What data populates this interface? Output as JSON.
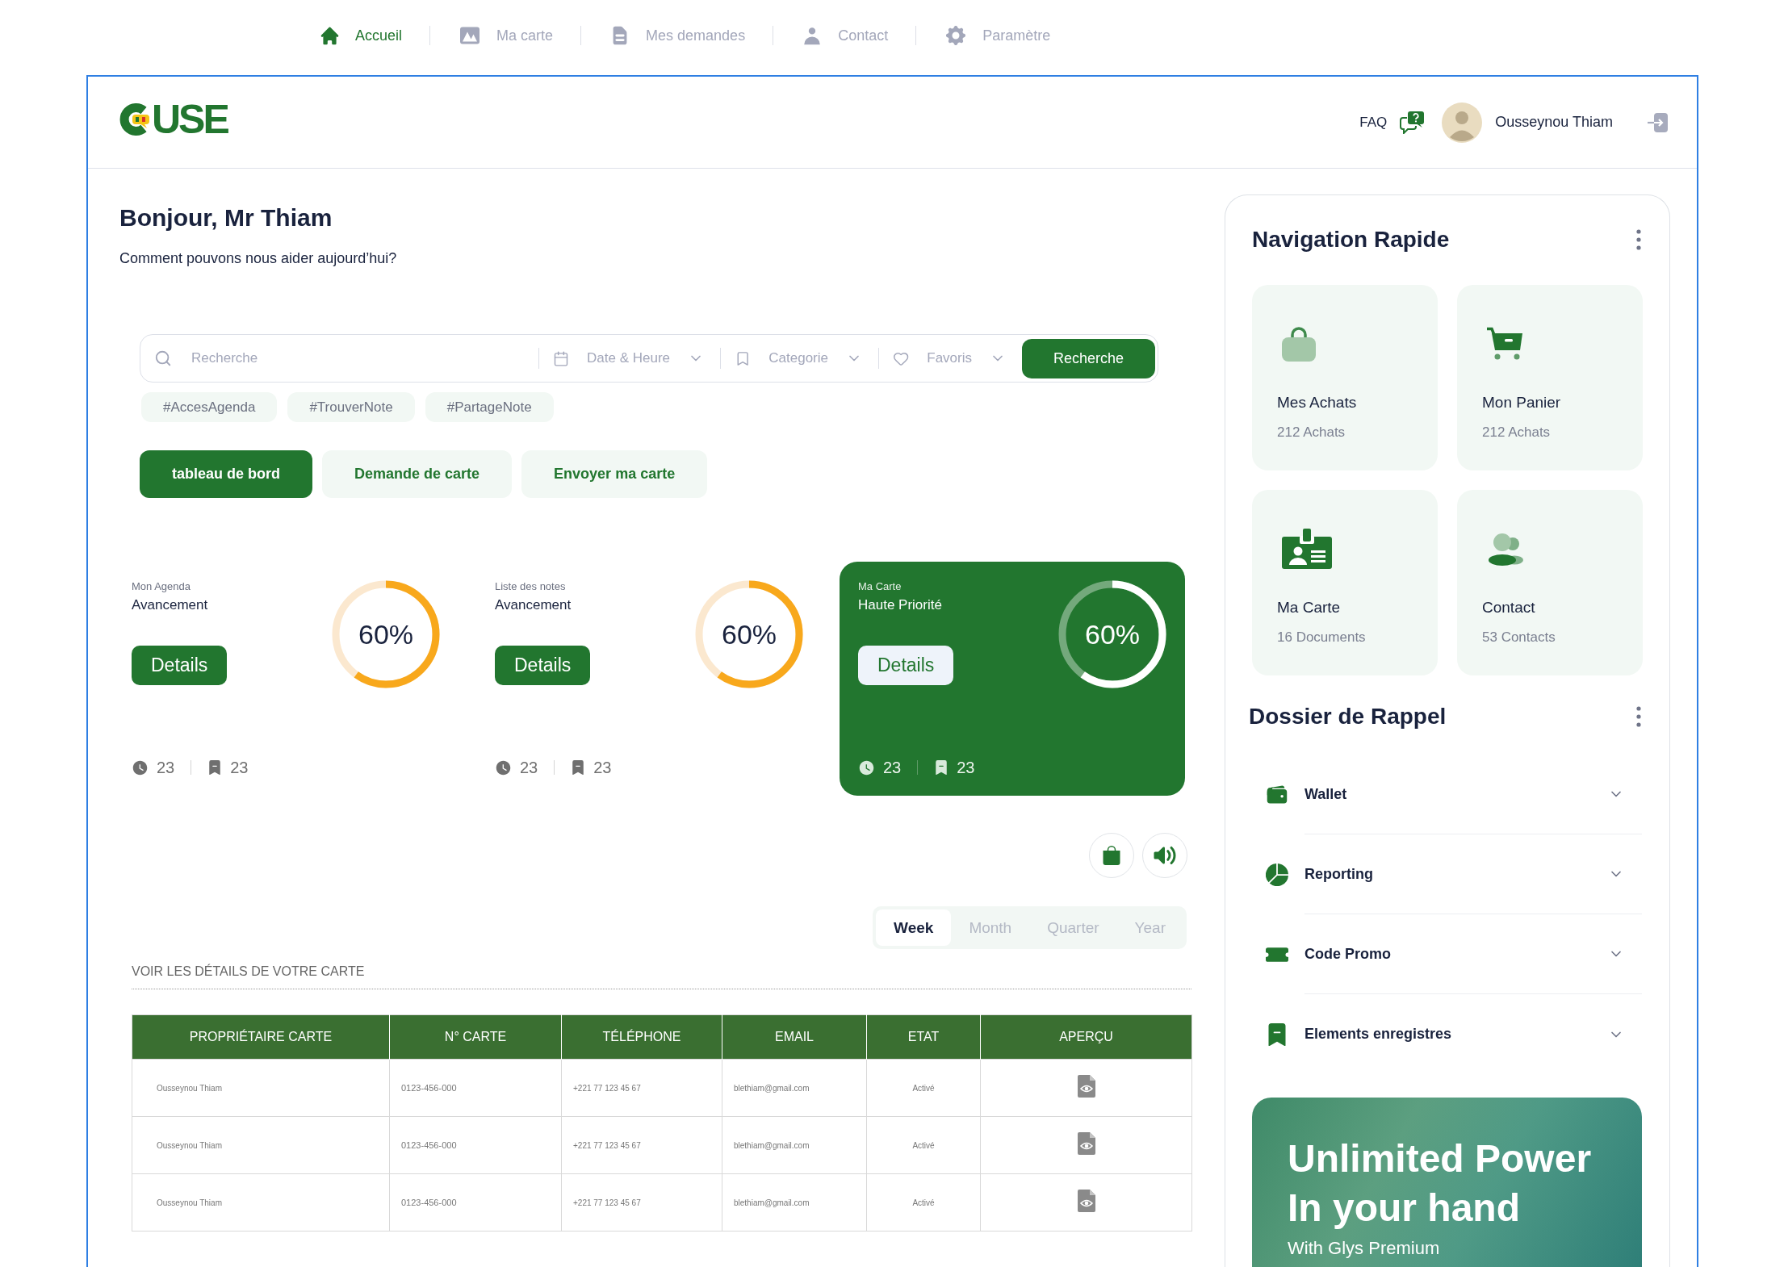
{
  "top_nav": {
    "items": [
      {
        "label": "Accueil",
        "selected": true
      },
      {
        "label": "Ma carte",
        "selected": false
      },
      {
        "label": "Mes demandes",
        "selected": false
      },
      {
        "label": "Contact",
        "selected": false
      },
      {
        "label": "Paramètre",
        "selected": false
      }
    ]
  },
  "header": {
    "logo": "USE",
    "faq": "FAQ",
    "user_name": "Ousseynou Thiam"
  },
  "greeting": {
    "title": "Bonjour, Mr Thiam",
    "subtitle": "Comment pouvons nous aider aujourd’hui?"
  },
  "search": {
    "placeholder": "Recherche",
    "filters": [
      "Date & Heure",
      "Categorie",
      "Favoris"
    ],
    "button": "Recherche"
  },
  "tags": [
    "#AccesAgenda",
    "#TrouverNote",
    "#PartageNote"
  ],
  "action_tabs": [
    {
      "label": "tableau de bord",
      "selected": true
    },
    {
      "label": "Demande de carte",
      "selected": false
    },
    {
      "label": "Envoyer ma carte",
      "selected": false
    }
  ],
  "progress_cards": [
    {
      "caption": "Mon Agenda",
      "title": "Avancement",
      "button": "Details",
      "level": 0.6,
      "reading": "60%",
      "time_count": "23",
      "saved_count": "23",
      "highlighted": false
    },
    {
      "caption": "Liste des notes",
      "title": "Avancement",
      "button": "Details",
      "level": 0.6,
      "reading": "60%",
      "time_count": "23",
      "saved_count": "23",
      "highlighted": false
    },
    {
      "caption": "Ma Carte",
      "title": "Haute Priorité",
      "button": "Details",
      "level": 0.6,
      "reading": "60%",
      "time_count": "23",
      "saved_count": "23",
      "highlighted": true
    }
  ],
  "period_tabs": [
    {
      "label": "Week",
      "selected": true
    },
    {
      "label": "Month",
      "selected": false
    },
    {
      "label": "Quarter",
      "selected": false
    },
    {
      "label": "Year",
      "selected": false
    }
  ],
  "card_details": {
    "title": "VOIR LES DÉTAILS DE VOTRE CARTE",
    "columns": [
      "PROPRIÉTAIRE CARTE",
      "N° CARTE",
      "TÉLÉPHONE",
      "EMAIL",
      "ETAT",
      "APERÇU"
    ],
    "rows": [
      [
        "Ousseynou Thiam",
        "0123-456-000",
        "+221 77 123 45 67",
        "blethiam@gmail.com",
        "Activé"
      ],
      [
        "Ousseynou Thiam",
        "0123-456-000",
        "+221 77 123 45 67",
        "blethiam@gmail.com",
        "Activé"
      ],
      [
        "Ousseynou Thiam",
        "0123-456-000",
        "+221 77 123 45 67",
        "blethiam@gmail.com",
        "Activé"
      ]
    ]
  },
  "quick_nav": {
    "title": "Navigation Rapide",
    "tiles": [
      {
        "title": "Mes Achats",
        "subtitle": "212 Achats"
      },
      {
        "title": "Mon Panier",
        "subtitle": "212 Achats"
      },
      {
        "title": "Ma Carte",
        "subtitle": "16 Documents"
      },
      {
        "title": "Contact",
        "subtitle": "53 Contacts"
      }
    ]
  },
  "reminders": {
    "title": "Dossier de Rappel",
    "items": [
      {
        "label": "Wallet",
        "expanded": false
      },
      {
        "label": "Reporting",
        "expanded": false
      },
      {
        "label": "Code Promo",
        "expanded": false
      },
      {
        "label": "Elements enregistres",
        "expanded": false
      }
    ]
  },
  "promo": {
    "title": "Unlimited Power In your hand",
    "subtitle": "With Glys Premium"
  }
}
